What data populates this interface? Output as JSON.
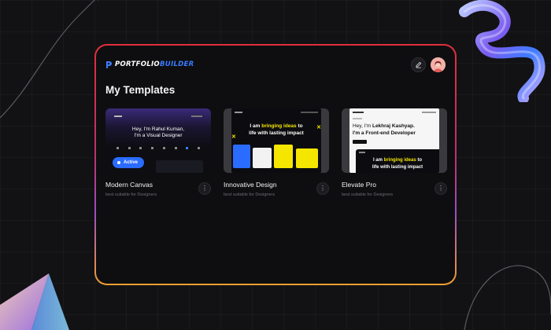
{
  "brand": {
    "part1": "PORTFOLIO",
    "part2": "BUILDER",
    "accent": "#3a7bff"
  },
  "header": {
    "edit_icon": "pencil-icon",
    "avatar_icon": "user-avatar"
  },
  "page": {
    "title": "My Templates"
  },
  "templates": [
    {
      "name": "Modern Canvas",
      "subtitle": "best suitable for Designers",
      "active_label": "Active",
      "preview": {
        "headline_1": "Hey, I'm Rahul Kuman,",
        "headline_2": "I'm a Visual Designer"
      }
    },
    {
      "name": "Innovative Design",
      "subtitle": "best suitable for Designers",
      "preview": {
        "headline_1a": "I am ",
        "headline_1b": "bringing ideas",
        "headline_1c": " to",
        "headline_2": "life with lasting impact"
      }
    },
    {
      "name": "Elevate Pro",
      "subtitle": "best suitable for Designers",
      "preview": {
        "headline_1a": "Hey, I'm ",
        "headline_1b": "Lekhraj Kashyap.",
        "headline_2": "I'm a Front-end Developer",
        "dark_1a": "I am ",
        "dark_1b": "bringing ideas",
        "dark_1c": " to",
        "dark_2": "life with lasting impact"
      }
    }
  ],
  "more_glyph": "⋮",
  "colors": {
    "frame_top": "#e0303a",
    "frame_bottom": "#f0a030",
    "active": "#2a6cff",
    "highlight": "#f5e600"
  }
}
